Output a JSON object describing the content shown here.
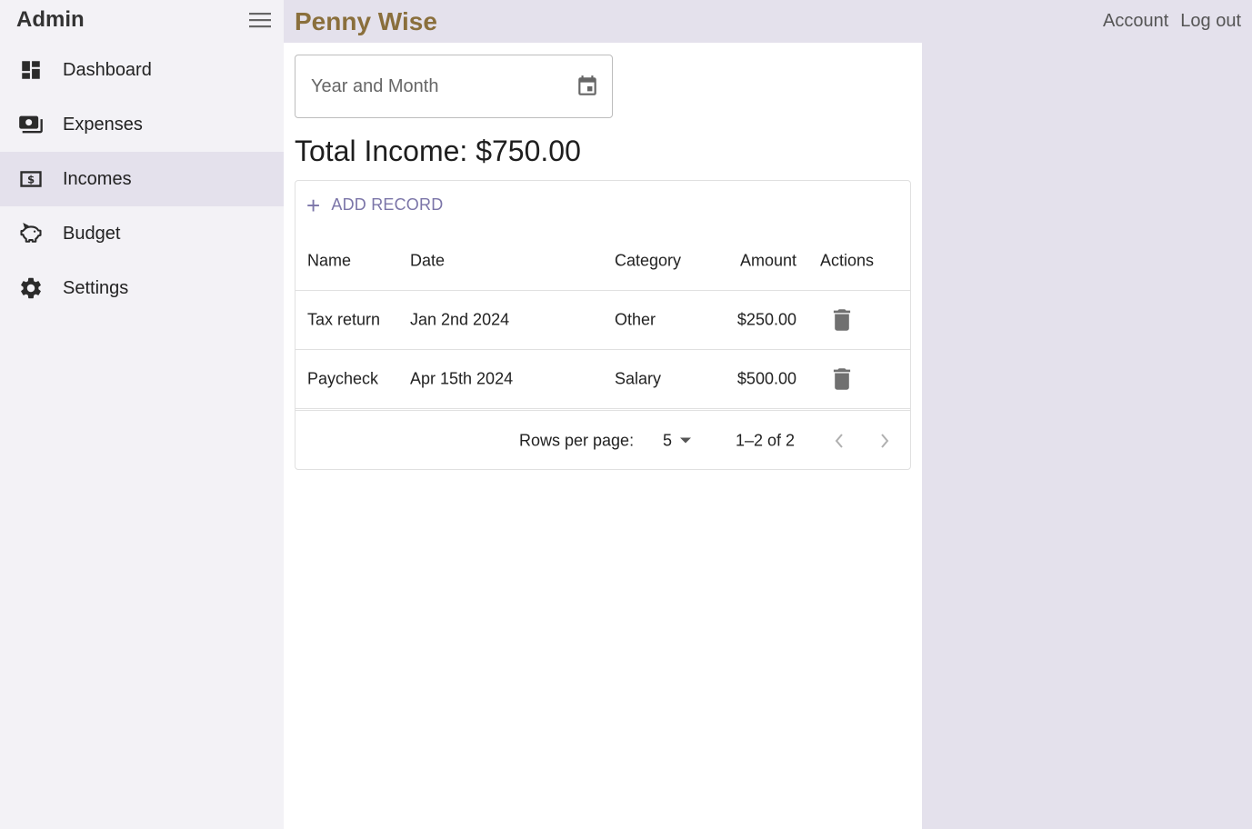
{
  "sidebar": {
    "title": "Admin",
    "menu_icon": "hamburger-menu-icon",
    "items": [
      {
        "label": "Dashboard",
        "icon": "dashboard-icon",
        "active": false
      },
      {
        "label": "Expenses",
        "icon": "payments-icon",
        "active": false
      },
      {
        "label": "Incomes",
        "icon": "dollar-bill-icon",
        "active": true
      },
      {
        "label": "Budget",
        "icon": "piggy-bank-icon",
        "active": false
      },
      {
        "label": "Settings",
        "icon": "gear-icon",
        "active": false
      }
    ]
  },
  "topbar": {
    "brand": "Penny Wise",
    "links": [
      "Account",
      "Log out"
    ]
  },
  "filter": {
    "placeholder": "Year and Month",
    "icon": "calendar-icon"
  },
  "summary": {
    "total_text": "Total Income: $750.00"
  },
  "grid": {
    "add_label": "ADD RECORD",
    "columns": [
      "Name",
      "Date",
      "Category",
      "Amount",
      "Actions"
    ],
    "rows": [
      {
        "name": "Tax return",
        "date": "Jan 2nd 2024",
        "category": "Other",
        "amount": "$250.00"
      },
      {
        "name": "Paycheck",
        "date": "Apr 15th 2024",
        "category": "Salary",
        "amount": "$500.00"
      }
    ],
    "footer": {
      "rows_per_page_label": "Rows per page:",
      "rows_per_page_value": "5",
      "page_info": "1–2 of 2"
    }
  },
  "colors": {
    "brand": "#8a6f3c",
    "accent": "#7b75a8",
    "sidebar_bg": "#f3f2f6",
    "app_bg": "#e4e1ec"
  }
}
